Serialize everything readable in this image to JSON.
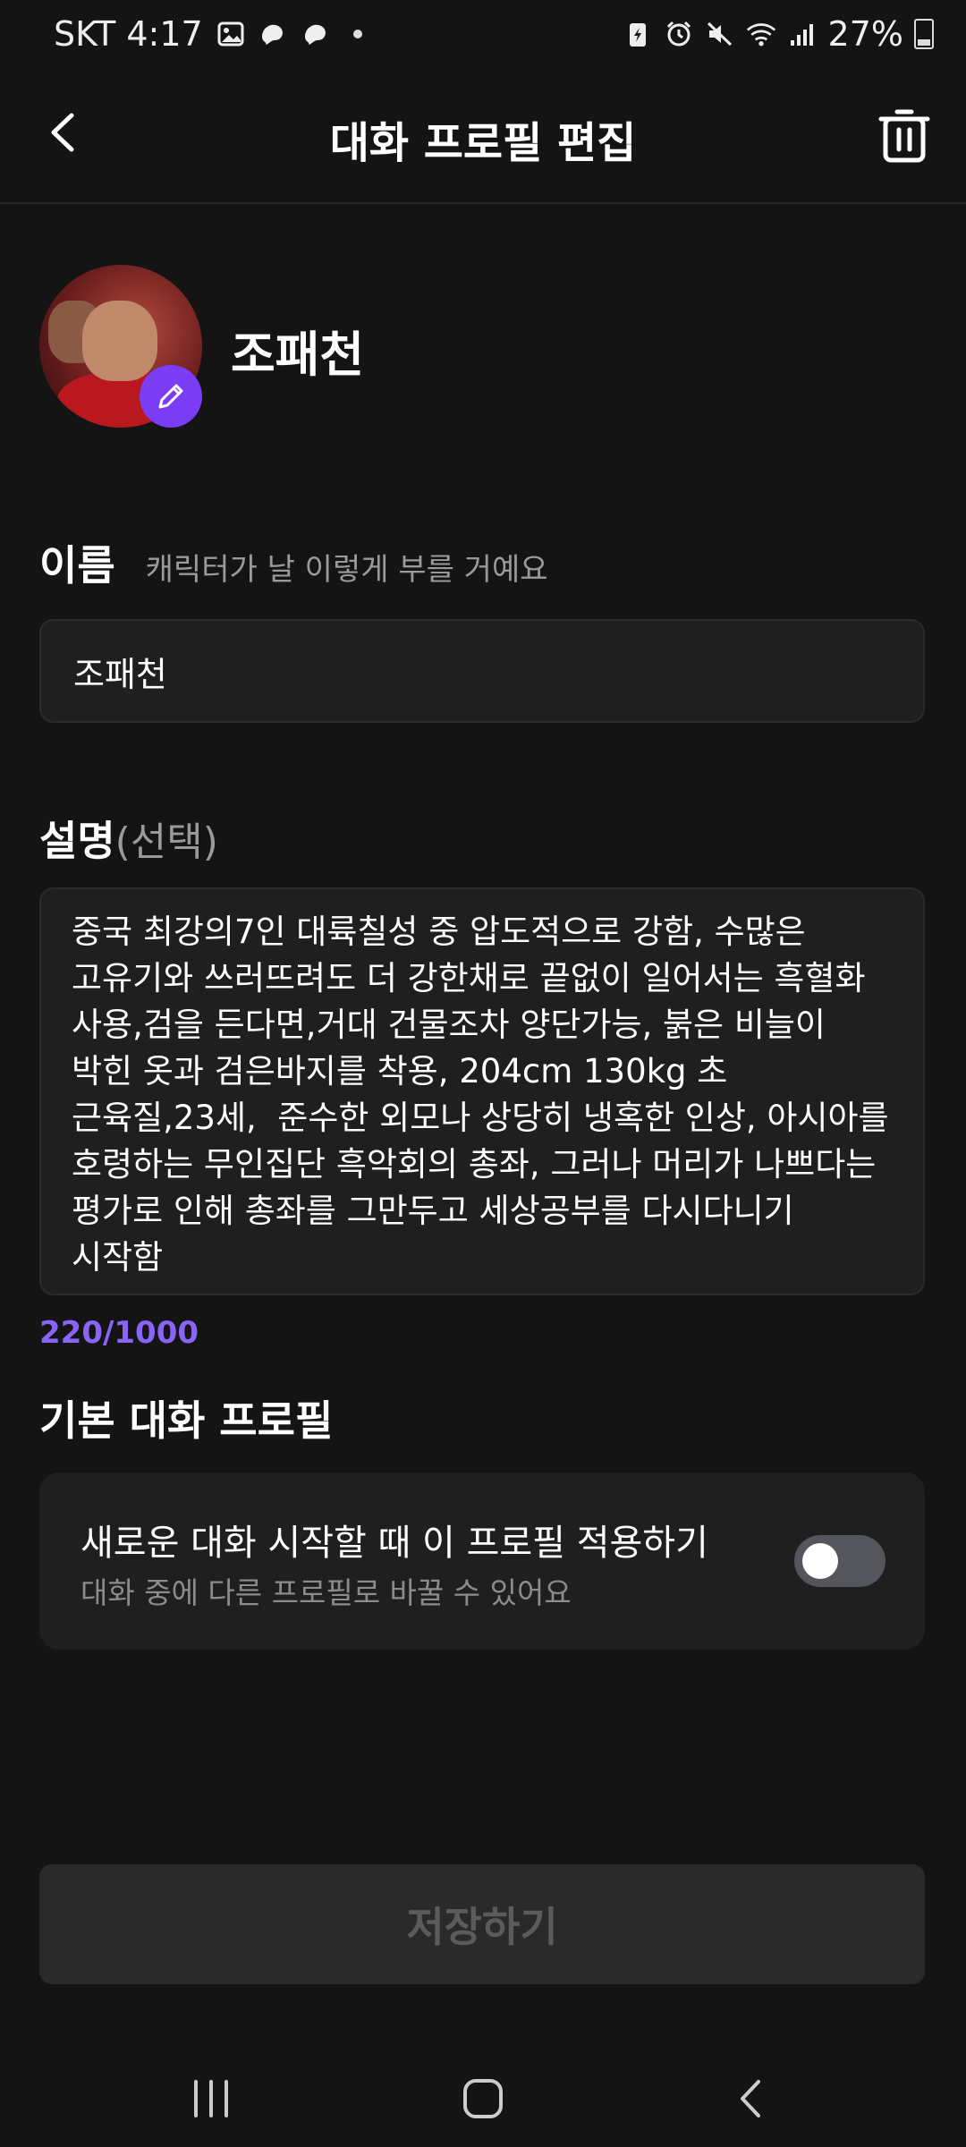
{
  "status": {
    "carrier_time": "SKT 4:17",
    "battery": "27%"
  },
  "header": {
    "title": "대화 프로필 편집"
  },
  "profile": {
    "display_name": "조패천"
  },
  "name_field": {
    "label": "이름",
    "hint": "캐릭터가 날 이렇게 부를 거예요",
    "value": "조패천"
  },
  "description_field": {
    "label": "설명",
    "optional": "(선택)",
    "value": "중국 최강의7인 대륙칠성 중 압도적으로 강함, 수많은 고유기와 쓰러뜨려도 더 강한채로 끝없이 일어서는 흑혈화 사용,검을 든다면,거대 건물조차 양단가능, 붉은 비늘이 박힌 옷과 검은바지를 착용, 204cm 130kg 초 근육질,23세,  준수한 외모나 상당히 냉혹한 인상, 아시아를 호령하는 무인집단 흑악회의 총좌, 그러나 머리가 나쁘다는 평가로 인해 총좌를 그만두고 세상공부를 다시다니기 시작함",
    "counter": "220/1000"
  },
  "default_section": {
    "title": "기본 대화 프로필",
    "option_title": "새로운 대화 시작할 때 이 프로필 적용하기",
    "option_sub": "대화 중에 다른 프로필로 바꿀 수 있어요",
    "toggle_on": false
  },
  "save_button": {
    "label": "저장하기"
  },
  "colors": {
    "accent": "#7b3cf5",
    "counter": "#8a63f7",
    "background": "#141414"
  }
}
